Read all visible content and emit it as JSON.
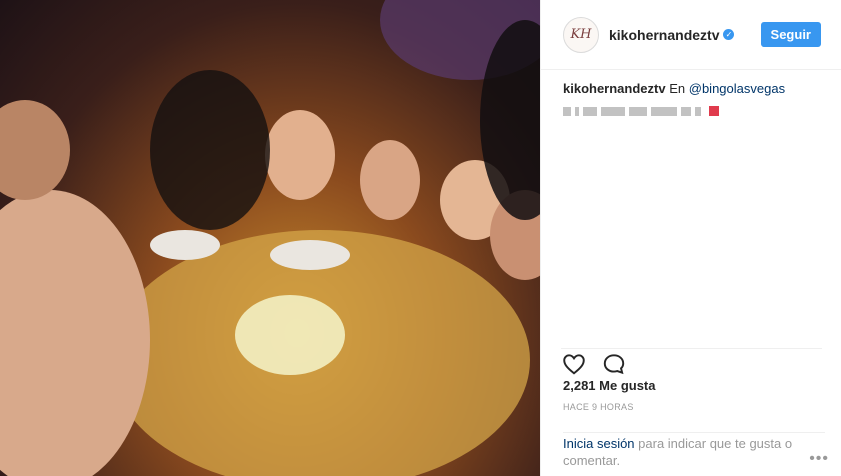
{
  "photo": {
    "description_icon": "party-photo"
  },
  "header": {
    "avatar_initials": "KH",
    "username": "kikohernandeztv",
    "verified_glyph": "✓",
    "follow_label": "Seguir"
  },
  "caption": {
    "username": "kikohernandeztv",
    "prefix": "En",
    "location": "@bingolasvegas"
  },
  "stats": {
    "likes": "2,281 Me gusta",
    "time": "HACE 9 HORAS"
  },
  "login": {
    "link": "Inicia sesión",
    "text": " para indicar que te gusta o comentar."
  },
  "menu": {
    "dots": "•••"
  },
  "colors": {
    "accent": "#3897f0",
    "link": "#003569",
    "muted": "#999999"
  }
}
